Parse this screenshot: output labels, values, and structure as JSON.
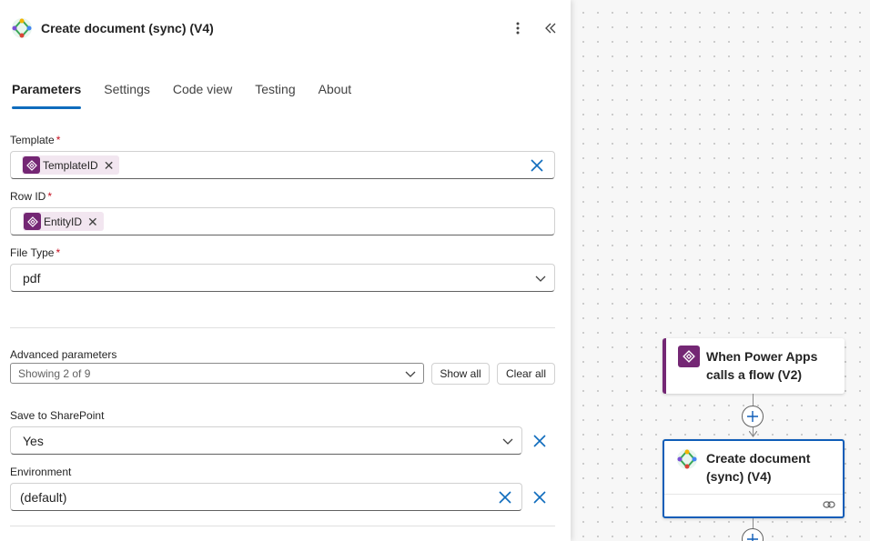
{
  "panel": {
    "title": "Create document (sync) (V4)",
    "tabs": [
      {
        "label": "Parameters",
        "active": true
      },
      {
        "label": "Settings",
        "active": false
      },
      {
        "label": "Code view",
        "active": false
      },
      {
        "label": "Testing",
        "active": false
      },
      {
        "label": "About",
        "active": false
      }
    ],
    "fields": {
      "template": {
        "label": "Template",
        "required": "*",
        "token": "TemplateID"
      },
      "row_id": {
        "label": "Row ID",
        "required": "*",
        "token": "EntityID"
      },
      "file_type": {
        "label": "File Type",
        "required": "*",
        "value": "pdf"
      }
    },
    "advanced": {
      "label": "Advanced parameters",
      "value": "Showing 2 of 9",
      "show_all": "Show all",
      "clear_all": "Clear all"
    },
    "save_to_sharepoint": {
      "label": "Save to SharePoint",
      "value": "Yes"
    },
    "environment": {
      "label": "Environment",
      "value": "(default)"
    }
  },
  "canvas": {
    "trigger_node": {
      "title": "When Power Apps calls a flow (V2)",
      "icon": "power-apps-icon"
    },
    "action_node": {
      "title": "Create document (sync) (V4)",
      "icon": "connector-icon"
    }
  },
  "colors": {
    "accent": "#0f6cbd",
    "powerapps": "#742774",
    "required": "#c50f1f"
  }
}
